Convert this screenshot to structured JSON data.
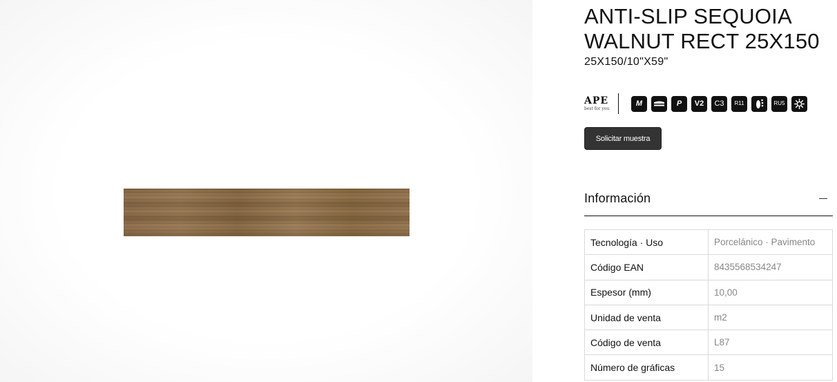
{
  "product": {
    "title_line1": "ANTI-SLIP SEQUOIA",
    "title_line2": "WALNUT RECT 25X150",
    "size": "25X150/10\"X59\""
  },
  "brand": {
    "name": "APE",
    "tagline": "best for you"
  },
  "features": [
    {
      "icon": "matt-finish-icon",
      "text": "M"
    },
    {
      "icon": "edge-profile-icon",
      "text": ""
    },
    {
      "icon": "porcelain-icon",
      "text": "P"
    },
    {
      "icon": "shade-variation-icon",
      "text": "V2"
    },
    {
      "icon": "c3-rating-icon",
      "text": "C3"
    },
    {
      "icon": "slip-resistance-icon",
      "text": "R11"
    },
    {
      "icon": "barefoot-slip-icon",
      "text": ""
    },
    {
      "icon": "ru5-rating-icon",
      "text": "RU5"
    },
    {
      "icon": "frost-resistant-icon",
      "text": ""
    }
  ],
  "actions": {
    "request_sample": "Solicitar muestra"
  },
  "info": {
    "title": "Información",
    "rows": [
      {
        "label": "Tecnología · Uso",
        "value": "Porcelánico · Pavimento"
      },
      {
        "label": "Código EAN",
        "value": "8435568534247"
      },
      {
        "label": "Espesor (mm)",
        "value": "10,00"
      },
      {
        "label": "Unidad de venta",
        "value": "m2"
      },
      {
        "label": "Código de venta",
        "value": "L87"
      },
      {
        "label": "Número de gráficas",
        "value": "15"
      }
    ]
  }
}
